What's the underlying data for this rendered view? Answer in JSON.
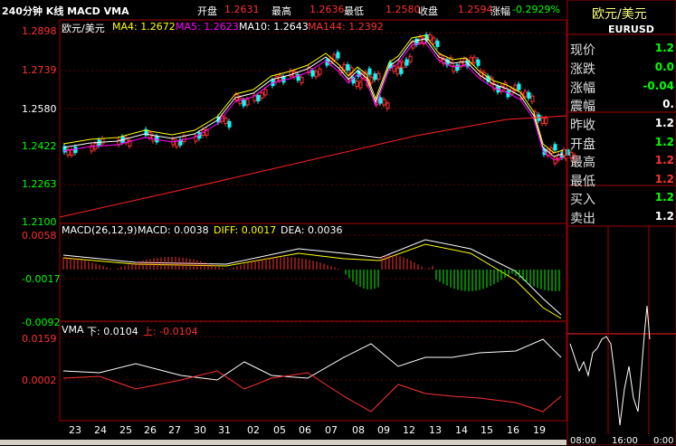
{
  "header": {
    "period_title": "240分钟 K线 MACD VMA",
    "open_label": "开盘",
    "open_value": "1.2631",
    "high_label": "最高",
    "high_value": "1.2636",
    "low_label": "最低",
    "low_value": "1.2580",
    "close_label": "收盘",
    "close_value": "1.2594",
    "change_label": "涨幅",
    "change_value": "-0.2929%"
  },
  "main_panel": {
    "symbol": "欧元/美元",
    "ma4": "MA4: 1.2672",
    "ma5": "MA5: 1.2623",
    "ma10": "MA10: 1.2643",
    "ma144": "MA144: 1.2392",
    "y_ticks": [
      "1.2898",
      "1.2739",
      "1.2580",
      "1.2422",
      "1.2263",
      "1.2100"
    ]
  },
  "macd_panel": {
    "label": "MACD(26,12,9)",
    "macd": "MACD: 0.0038",
    "diff": "DIFF: 0.0017",
    "dea": "DEA: 0.0036",
    "y_ticks": [
      "0.0058",
      "-0.0017",
      "-0.0092"
    ]
  },
  "vma_panel": {
    "label": "VMA",
    "down": "下: 0.0104",
    "up": "上: -0.0104",
    "y_ticks": [
      "0.0159",
      "0.0002"
    ]
  },
  "x_axis": [
    "23",
    "24",
    "25",
    "26",
    "27",
    "30",
    "31",
    "02",
    "05",
    "06",
    "07",
    "08",
    "09",
    "12",
    "13",
    "14",
    "15",
    "16",
    "19"
  ],
  "quote": {
    "name": "欧元/美元",
    "code": "EURUSD",
    "rows": [
      {
        "label": "现价",
        "value": "1.2"
      },
      {
        "label": "涨跌",
        "value": "0.0"
      },
      {
        "label": "涨幅",
        "value": "-0.04"
      },
      {
        "label": "震幅",
        "value": "0."
      },
      {
        "label": "昨收",
        "value": "1.2"
      },
      {
        "label": "开盘",
        "value": "1.2"
      },
      {
        "label": "最高",
        "value": "1.2"
      },
      {
        "label": "最低",
        "value": "1.2"
      },
      {
        "label": "买入",
        "value": "1.2"
      },
      {
        "label": "卖出",
        "value": "1.2"
      }
    ],
    "mini_times": [
      "08:00",
      "16:00",
      "0:00"
    ]
  },
  "colors": {
    "up": "#ff3030",
    "down": "#00ffff",
    "ma4": "#ffffff",
    "ma5": "#ff00ff",
    "ma10": "#ffff00",
    "ma144": "#ff2020",
    "frame": "#a00000"
  }
}
